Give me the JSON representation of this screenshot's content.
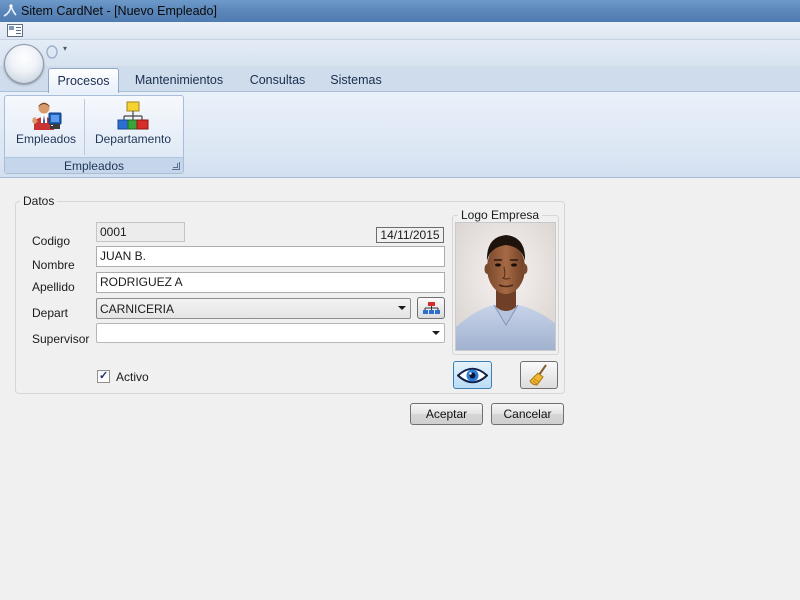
{
  "window": {
    "title": "Sitem CardNet - [Nuevo Empleado]"
  },
  "ribbon": {
    "tabs": [
      {
        "label": "Procesos",
        "active": true
      },
      {
        "label": "Mantenimientos",
        "active": false
      },
      {
        "label": "Consultas",
        "active": false
      },
      {
        "label": "Sistemas",
        "active": false
      }
    ],
    "group": {
      "label": "Empleados",
      "buttons": [
        {
          "label": "Empleados",
          "icon": "employee-icon"
        },
        {
          "label": "Departamento",
          "icon": "org-chart-icon"
        }
      ]
    }
  },
  "form": {
    "group_label": "Datos",
    "fields": {
      "codigo": {
        "label": "Codigo",
        "value": "0001"
      },
      "fecha": {
        "value": "14/11/2015"
      },
      "nombre": {
        "label": "Nombre",
        "value": "JUAN B."
      },
      "apellido": {
        "label": "Apellido",
        "value": "RODRIGUEZ A"
      },
      "depart": {
        "label": "Depart",
        "value": "CARNICERIA"
      },
      "supervisor": {
        "label": "Supervisor",
        "value": ""
      },
      "activo": {
        "label": "Activo",
        "checked": true
      }
    },
    "logo": {
      "label": "Logo Empresa",
      "view_icon": "eye-icon",
      "clear_icon": "broom-icon"
    },
    "actions": {
      "accept": "Aceptar",
      "cancel": "Cancelar"
    }
  }
}
